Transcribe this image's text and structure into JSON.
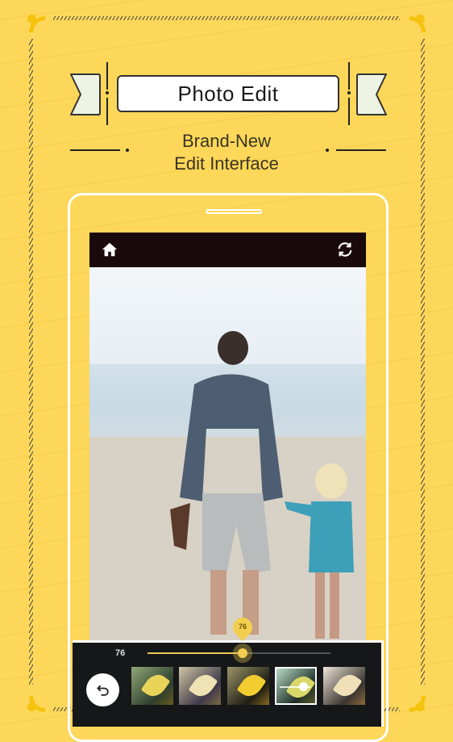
{
  "header": {
    "title": "Photo Edit",
    "subtitle_line1": "Brand-New",
    "subtitle_line2": "Edit Interface"
  },
  "app_bar": {
    "left_icon": "home-icon",
    "right_icon": "refresh-icon"
  },
  "photo": {
    "description": "Father and child walking hand in hand on a beach"
  },
  "adjustment": {
    "value_label": "76",
    "pin_label": "76",
    "value_percent": 0.52,
    "accent_color": "#f2cf4f"
  },
  "undo_button": {
    "icon": "undo-icon"
  },
  "filters": [
    {
      "name": "filter-1",
      "bg": "linear-gradient(135deg,#8fa777,#2d3f2c 70%,#6a5a1f)",
      "leaf": "#e9d45a",
      "selected": false
    },
    {
      "name": "filter-2",
      "bg": "linear-gradient(135deg,#cfc6a4,#3f3a4a 70%,#7d6a45)",
      "leaf": "#efe2b4",
      "selected": false
    },
    {
      "name": "filter-3",
      "bg": "linear-gradient(135deg,#9c9668,#1f1d14 70%,#8b6a20)",
      "leaf": "#f1cd30",
      "selected": false
    },
    {
      "name": "filter-4",
      "bg": "linear-gradient(135deg,#b9dcc6,#203028 70%,#5c5a2a)",
      "leaf": "#d9d96a",
      "selected": true
    },
    {
      "name": "filter-5",
      "bg": "linear-gradient(135deg,#efe6d9,#3a3530 70%,#8b6a3a)",
      "leaf": "#efe0b8",
      "selected": false
    }
  ],
  "colors": {
    "background": "#fcd75a",
    "app_bar": "#1a0a0c",
    "panel": "#161718"
  }
}
